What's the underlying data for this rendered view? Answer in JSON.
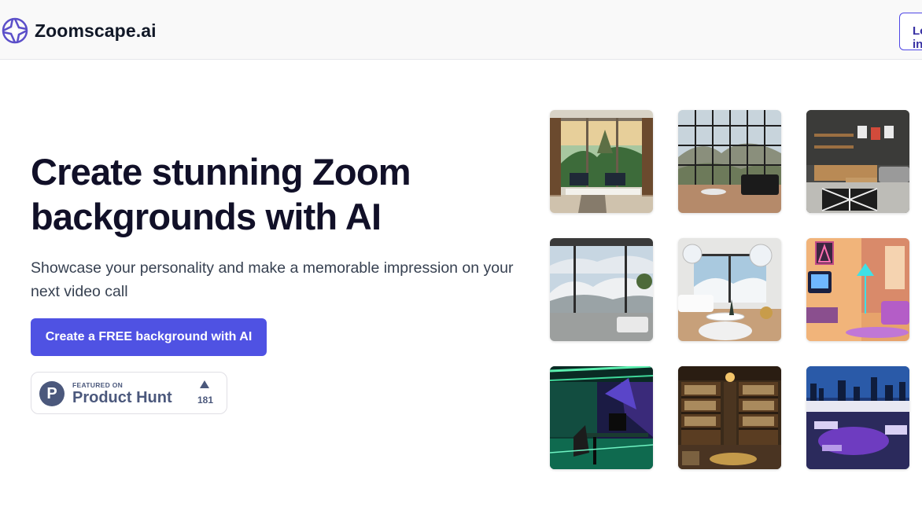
{
  "header": {
    "brand": "Zoomscape.ai",
    "login_label": "Log in"
  },
  "hero": {
    "title": "Create stunning Zoom backgrounds with AI",
    "subtitle": "Showcase your personality and make a memorable impression on your next video call",
    "cta_label": "Create a FREE background with AI"
  },
  "product_hunt": {
    "featured": "FEATURED ON",
    "name": "Product Hunt",
    "logo_letter": "P",
    "count": "181"
  },
  "gallery": [
    {
      "icon": "office-jungle-view-image"
    },
    {
      "icon": "living-room-mountain-window-image"
    },
    {
      "icon": "modern-living-room-shelves-image"
    },
    {
      "icon": "snowy-landscape-room-image"
    },
    {
      "icon": "snow-lounge-chandelier-image"
    },
    {
      "icon": "retro-neon-room-image"
    },
    {
      "icon": "green-neon-office-image"
    },
    {
      "icon": "library-bookshelves-image"
    },
    {
      "icon": "rooftop-city-lounge-image"
    }
  ],
  "colors": {
    "accent": "#4f52e3",
    "brand_purple": "#5b4fc9",
    "product_hunt": "#4b587c"
  }
}
